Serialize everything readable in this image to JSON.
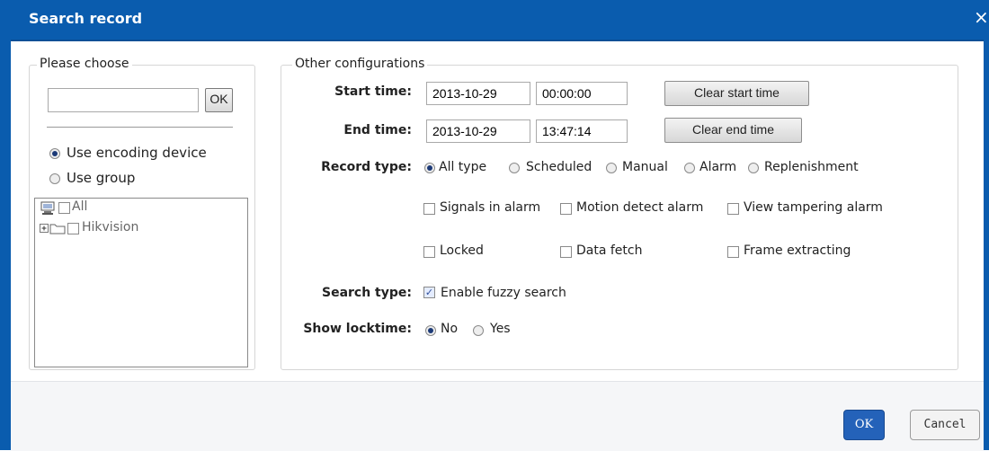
{
  "window": {
    "title": "Search record",
    "close_glyph": "×"
  },
  "left_panel": {
    "legend": "Please choose",
    "search_value": "",
    "ok_label": "OK",
    "device_options": [
      {
        "label": "Use encoding device",
        "selected": true
      },
      {
        "label": "Use group",
        "selected": false
      }
    ],
    "tree": [
      {
        "label": "All",
        "icon": "computer-icon",
        "checked": false
      },
      {
        "label": "Hikvision",
        "icon": "folder-icon",
        "expand": "+",
        "checked": false
      }
    ]
  },
  "right_panel": {
    "legend": "Other configurations",
    "start_time": {
      "label": "Start time:",
      "date": "2013-10-29",
      "time": "00:00:00",
      "clear_label": "Clear start time"
    },
    "end_time": {
      "label": "End time:",
      "date": "2013-10-29",
      "time": "13:47:14",
      "clear_label": "Clear end time"
    },
    "record_type": {
      "label": "Record type:",
      "options": [
        {
          "label": "All type",
          "selected": true
        },
        {
          "label": "Scheduled",
          "selected": false
        },
        {
          "label": "Manual",
          "selected": false
        },
        {
          "label": "Alarm",
          "selected": false
        },
        {
          "label": "Replenishment",
          "selected": false
        }
      ]
    },
    "alarm_checks": [
      {
        "label": "Signals in alarm",
        "checked": false
      },
      {
        "label": "Motion detect alarm",
        "checked": false
      },
      {
        "label": "View tampering alarm",
        "checked": false
      }
    ],
    "other_checks": [
      {
        "label": "Locked",
        "checked": false
      },
      {
        "label": "Data fetch",
        "checked": false
      },
      {
        "label": "Frame extracting",
        "checked": false
      }
    ],
    "search_type": {
      "label": "Search type:",
      "option": "Enable fuzzy search",
      "checked": true
    },
    "show_locktime": {
      "label": "Show locktime:",
      "options": [
        {
          "label": "No",
          "selected": true
        },
        {
          "label": "Yes",
          "selected": false
        }
      ]
    }
  },
  "footer": {
    "ok_label": "OK",
    "cancel_label": "Cancel"
  },
  "colors": {
    "titlebar": "#0a5cae",
    "primary_button": "#2462b9"
  }
}
